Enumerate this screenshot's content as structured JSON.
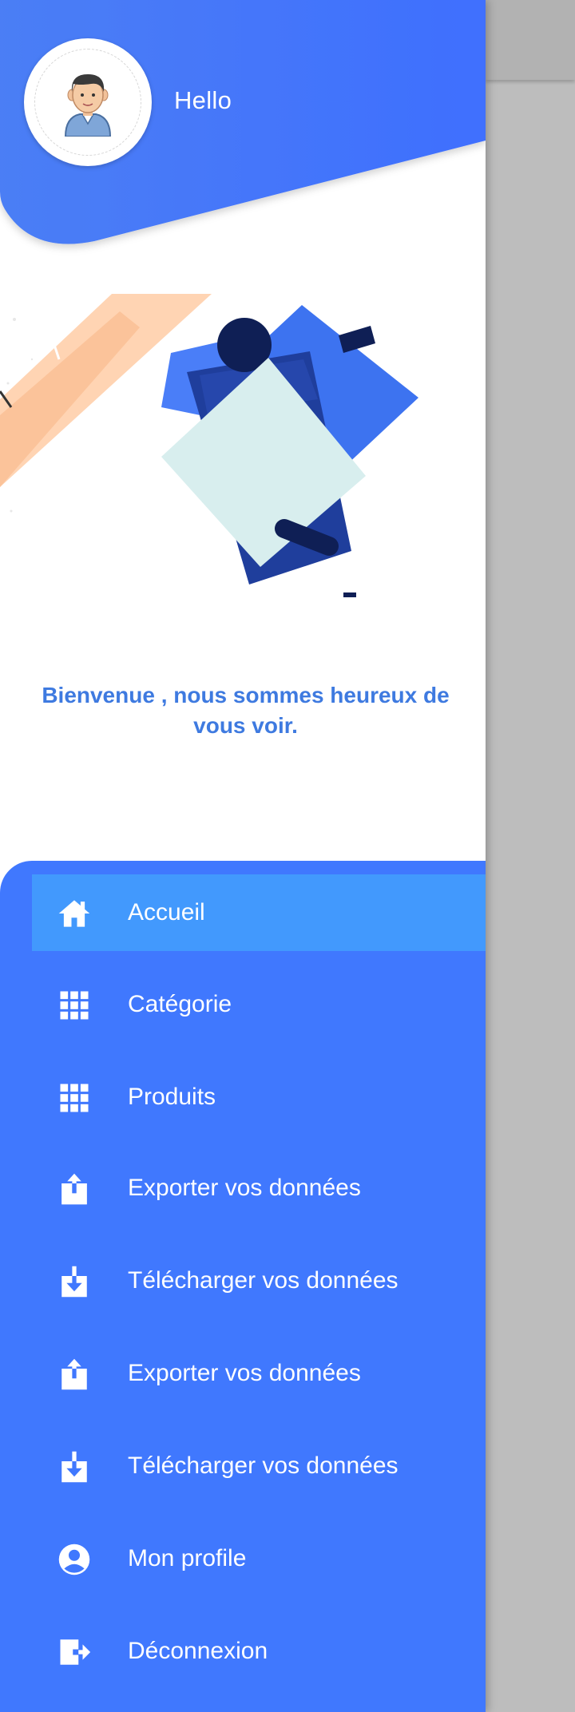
{
  "header": {
    "greeting": "Hello",
    "avatar_icon": "user-avatar-icon"
  },
  "welcome_text": "Bienvenue , nous sommes heureux de vous voir.",
  "menu": {
    "items": [
      {
        "label": "Accueil",
        "icon": "home-icon",
        "active": true
      },
      {
        "label": "Catégorie",
        "icon": "grid-icon",
        "active": false
      },
      {
        "label": "Produits",
        "icon": "grid-icon",
        "active": false
      },
      {
        "label": "Exporter vos données",
        "icon": "upload-icon",
        "active": false
      },
      {
        "label": "Télécharger vos données",
        "icon": "download-icon",
        "active": false
      },
      {
        "label": "Exporter vos données",
        "icon": "upload-icon",
        "active": false
      },
      {
        "label": "Télécharger vos données",
        "icon": "download-icon",
        "active": false
      },
      {
        "label": "Mon profile",
        "icon": "account-circle-icon",
        "active": false
      },
      {
        "label": "Déconnexion",
        "icon": "logout-icon",
        "active": false
      }
    ]
  },
  "colors": {
    "primary": "#4078fe",
    "active_item": "#4299fd",
    "welcome_text": "#3e7ae0",
    "scrim": "#bdbdbd"
  }
}
